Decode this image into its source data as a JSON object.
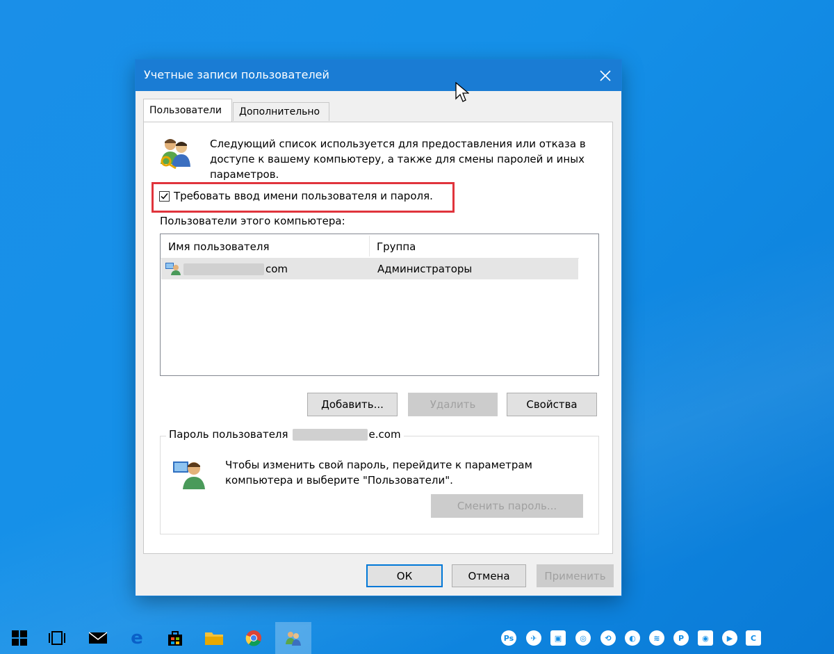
{
  "dialog": {
    "title": "Учетные записи пользователей",
    "close_glyph": "✕",
    "tabs": [
      {
        "label": "Пользователи",
        "active": true
      },
      {
        "label": "Дополнительно",
        "active": false
      }
    ],
    "intro_text": "Следующий список используется для предоставления или отказа в доступе к вашему компьютеру, а также для смены паролей и иных параметров.",
    "require_login": {
      "label": "Требовать ввод имени пользователя и пароля.",
      "checked": true
    },
    "users_label": "Пользователи этого компьютера:",
    "table": {
      "columns": [
        "Имя пользователя",
        "Группа"
      ],
      "rows": [
        {
          "user_suffix": "com",
          "group": "Администраторы"
        }
      ]
    },
    "buttons": {
      "add": "Добавить...",
      "remove": "Удалить",
      "properties": "Свойства"
    },
    "password_group": {
      "legend_prefix": "Пароль пользователя",
      "legend_suffix": "e.com",
      "text": "Чтобы изменить свой пароль, перейдите к параметрам компьютера и выберите \"Пользователи\".",
      "change_button": "Сменить пароль..."
    },
    "footer": {
      "ok": "ОК",
      "cancel": "Отмена",
      "apply": "Применить"
    }
  },
  "taskbar": {
    "apps": [
      "windows-start",
      "task-view",
      "mail",
      "edge",
      "store",
      "file-explorer",
      "chrome",
      "user-accounts"
    ],
    "tray": [
      "Ps",
      "✈",
      "▣",
      "◎",
      "⟲",
      "◐",
      "≋",
      "P",
      "◉",
      "▶",
      "C"
    ]
  },
  "colors": {
    "desktop": "#1590e8",
    "titlebar": "#1a7cd4",
    "highlight": "#e0343c"
  }
}
